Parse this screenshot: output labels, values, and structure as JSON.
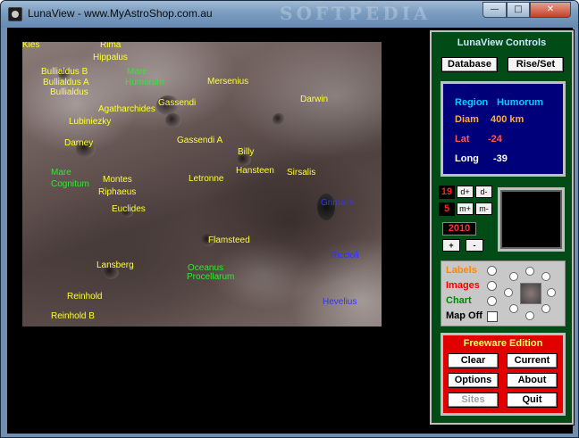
{
  "window": {
    "title": "LunaView - www.MyAstroShop.com.au",
    "watermark": "SOFTPEDIA",
    "min_glyph": "—",
    "max_glyph": "□",
    "close_glyph": "✕"
  },
  "map": {
    "labels": [
      {
        "text": "Kies",
        "color": "yellow"
      },
      {
        "text": "Rima",
        "color": "yellow"
      },
      {
        "text": "Hippalus",
        "color": "yellow"
      },
      {
        "text": "Bullialdus B",
        "color": "yellow"
      },
      {
        "text": "Bullialdus A",
        "color": "yellow"
      },
      {
        "text": "Bullialdus",
        "color": "yellow"
      },
      {
        "text": "Mare",
        "color": "green"
      },
      {
        "text": "Humorum",
        "color": "green"
      },
      {
        "text": "Mersenius",
        "color": "yellow"
      },
      {
        "text": "Gassendi",
        "color": "yellow"
      },
      {
        "text": "Darwin",
        "color": "yellow"
      },
      {
        "text": "Agatharchides",
        "color": "yellow"
      },
      {
        "text": "Lubiniezky",
        "color": "yellow"
      },
      {
        "text": "Darney",
        "color": "yellow"
      },
      {
        "text": "Gassendi A",
        "color": "yellow"
      },
      {
        "text": "Billy",
        "color": "yellow"
      },
      {
        "text": "Hansteen",
        "color": "yellow"
      },
      {
        "text": "Sirsalis",
        "color": "yellow"
      },
      {
        "text": "Mare",
        "color": "green"
      },
      {
        "text": "Cognitum",
        "color": "green"
      },
      {
        "text": "Montes",
        "color": "yellow"
      },
      {
        "text": "Riphaeus",
        "color": "yellow"
      },
      {
        "text": "Letronne",
        "color": "yellow"
      },
      {
        "text": "Grimaldi",
        "color": "blue"
      },
      {
        "text": "Euclides",
        "color": "yellow"
      },
      {
        "text": "Flamsteed",
        "color": "yellow"
      },
      {
        "text": "Riccioli",
        "color": "blue"
      },
      {
        "text": "Lansberg",
        "color": "yellow"
      },
      {
        "text": "Oceanus",
        "color": "green"
      },
      {
        "text": "Procellarum",
        "color": "green"
      },
      {
        "text": "Reinhold",
        "color": "yellow"
      },
      {
        "text": "Hevelius",
        "color": "blue"
      },
      {
        "text": "Reinhold B",
        "color": "yellow"
      }
    ]
  },
  "controls": {
    "title": "LunaView Controls",
    "database_label": "Database",
    "riseset_label": "Rise/Set",
    "region": {
      "label": "Region",
      "name": "Humorum",
      "diam_label": "Diam",
      "diam_value": "400 km",
      "lat_label": "Lat",
      "lat_value": "-24",
      "long_label": "Long",
      "long_value": "-39"
    },
    "day_value": "19",
    "day_plus": "d+",
    "day_minus": "d-",
    "month_value": "5",
    "month_plus": "m+",
    "month_minus": "m-",
    "year_value": "2010",
    "year_plus": "+",
    "year_minus": "-",
    "options": {
      "labels": "Labels",
      "images": "Images",
      "chart": "Chart",
      "map_off": "Map Off"
    },
    "freeware": {
      "title": "Freeware Edition",
      "clear": "Clear",
      "current": "Current",
      "options": "Options",
      "about": "About",
      "sites": "Sites",
      "quit": "Quit"
    }
  },
  "colors": {
    "panel_bg": "#004b16",
    "info_bg": "#00007a",
    "freeware_bg": "#e00000",
    "label_yellow": "#ffff33",
    "label_green": "#33e633",
    "label_blue": "#3333ff"
  }
}
